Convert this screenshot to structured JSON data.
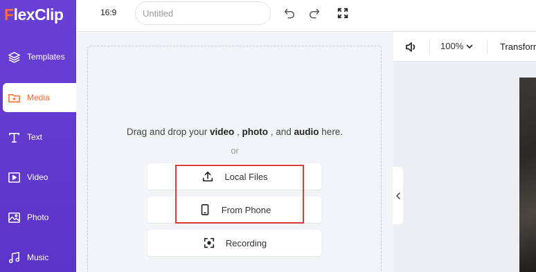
{
  "brand": {
    "name_first": "F",
    "name_rest": "lexClip",
    "accent": "#ff6a3d",
    "sidebar_color": "#6a3fd6"
  },
  "sidebar": {
    "items": [
      {
        "label": "Templates",
        "icon": "layers-icon"
      },
      {
        "label": "Media",
        "icon": "folder-plus-icon",
        "active": true
      },
      {
        "label": "Text",
        "icon": "text-icon"
      },
      {
        "label": "Video",
        "icon": "video-icon"
      },
      {
        "label": "Photo",
        "icon": "photo-icon"
      },
      {
        "label": "Music",
        "icon": "music-icon"
      }
    ]
  },
  "topbar": {
    "aspect_ratio": "16:9",
    "title_placeholder": "Untitled",
    "undo_icon": "undo-icon",
    "redo_icon": "redo-icon",
    "fullscreen_icon": "fullscreen-icon"
  },
  "upload": {
    "drag_prefix": "Drag and drop your ",
    "drag_video": "video",
    "drag_sep1": " , ",
    "drag_photo": "photo",
    "drag_sep2": " , and ",
    "drag_audio": "audio",
    "drag_suffix": " here.",
    "or": "or",
    "buttons": [
      {
        "label": "Local Files",
        "icon": "upload-icon"
      },
      {
        "label": "From Phone",
        "icon": "phone-icon"
      },
      {
        "label": "Recording",
        "icon": "record-icon"
      }
    ],
    "highlight_color": "#d93a3a"
  },
  "preview": {
    "zoom": "100%",
    "transform_label": "Transform"
  }
}
